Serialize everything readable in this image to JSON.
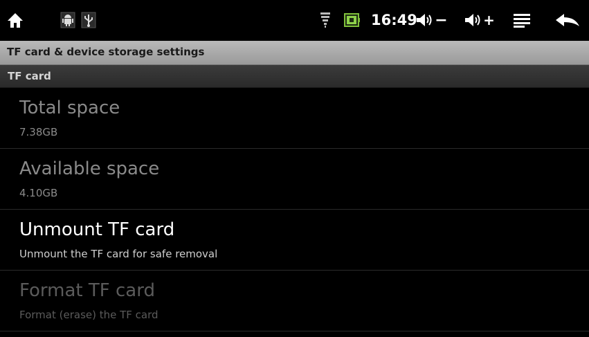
{
  "status_bar": {
    "time": "16:49",
    "icons": [
      "home-icon",
      "android-debug-icon",
      "usb-icon",
      "wifi-icon",
      "battery-icon",
      "volume-down-icon",
      "volume-up-icon",
      "menu-icon",
      "back-icon"
    ],
    "volume_down_label": "−",
    "volume_up_label": "+"
  },
  "title": "TF card & device storage settings",
  "category": "TF card",
  "prefs": [
    {
      "title": "Total space",
      "summary": "7.38GB"
    },
    {
      "title": "Available space",
      "summary": "4.10GB"
    },
    {
      "title": "Unmount TF card",
      "summary": "Unmount the TF card for safe removal"
    },
    {
      "title": "Format TF card",
      "summary": "Format (erase) the TF card"
    }
  ],
  "colors": {
    "background": "#000000",
    "titlebar": "#aaaaaa",
    "category_bar": "#333333",
    "text_enabled": "#ffffff",
    "text_disabled": "#8a8a8a"
  }
}
